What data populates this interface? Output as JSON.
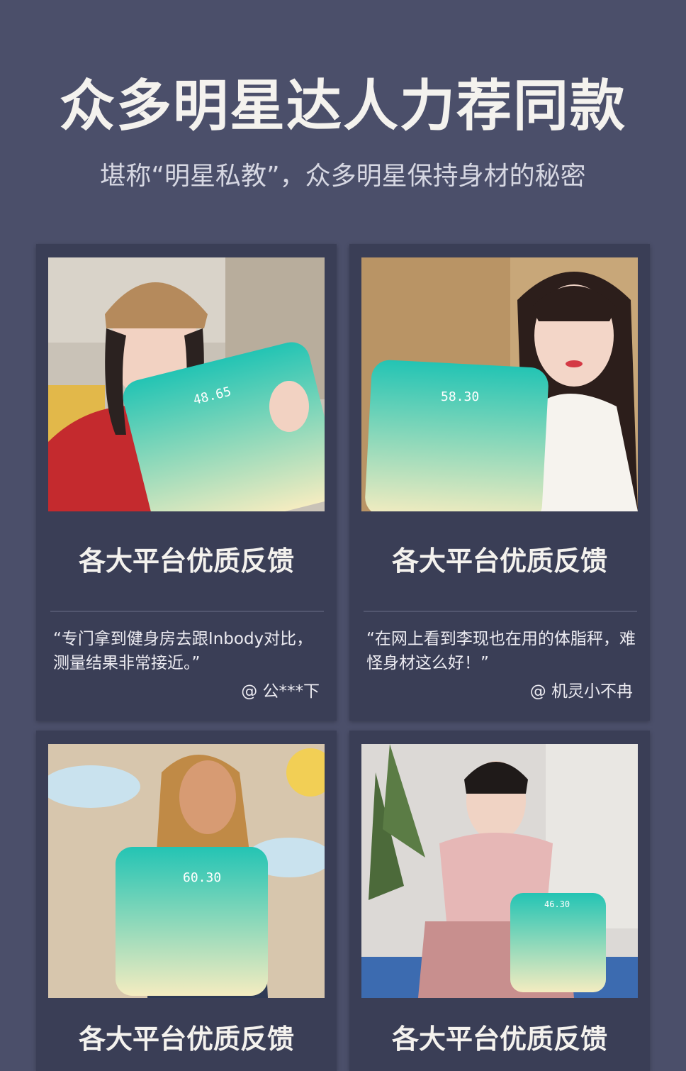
{
  "header": {
    "title": "众多明星达人力荐同款",
    "subtitle": "堪称“明星私教”，众多明星保持身材的秘密"
  },
  "cards": [
    {
      "title": "各大平台优质反馈",
      "quote": "“专门拿到健身房去跟Inbody对比，测量结果非常接近。”",
      "author": "@ 公***下",
      "scale_reading": "48.65"
    },
    {
      "title": "各大平台优质反馈",
      "quote": "“在网上看到李现也在用的体脂秤，难怪身材这么好！”",
      "author": "@ 机灵小不冉",
      "scale_reading": "58.30"
    },
    {
      "title": "各大平台优质反馈",
      "scale_reading": "60.30"
    },
    {
      "title": "各大平台优质反馈",
      "scale_reading": "46.30"
    }
  ],
  "colors": {
    "background": "#4b4f6a",
    "card": "#3a3e56",
    "scale_top": "#23c4b4",
    "scale_bottom": "#f4ecc0"
  }
}
